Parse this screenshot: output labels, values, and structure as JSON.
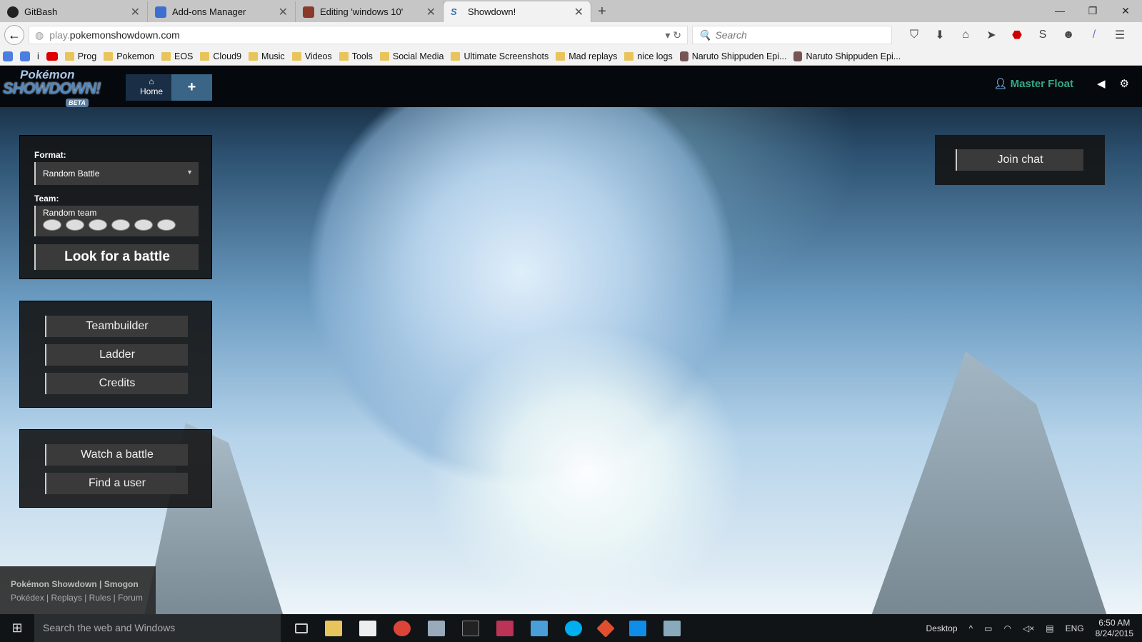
{
  "browser": {
    "tabs": [
      {
        "title": "GitBash",
        "icon": "github-icon"
      },
      {
        "title": "Add-ons Manager",
        "icon": "puzzle-icon"
      },
      {
        "title": "Editing 'windows 10'",
        "icon": "smogon-icon"
      },
      {
        "title": "Showdown!",
        "icon": "showdown-icon",
        "active": true
      }
    ],
    "new_tab": "+",
    "url_prefix": "play.",
    "url_domain": "pokemonshowdown.com",
    "search_placeholder": "Search",
    "bookmarks": [
      "i",
      "Prog",
      "Pokemon",
      "EOS",
      "Cloud9",
      "Music",
      "Videos",
      "Tools",
      "Social Media",
      "Ultimate Screenshots",
      "Mad replays",
      "nice logs",
      "Naruto Shippuden Epi...",
      "Naruto Shippuden Epi..."
    ]
  },
  "header": {
    "logo_top": "Pokémon",
    "logo_main": "SHOWDOWN!",
    "logo_badge": "BETA",
    "home": "Home",
    "add": "+",
    "username": "Master Float"
  },
  "battle_panel": {
    "format_label": "Format:",
    "format_value": "Random Battle",
    "team_label": "Team:",
    "team_value": "Random team",
    "look_button": "Look for a battle"
  },
  "menu": {
    "teambuilder": "Teambuilder",
    "ladder": "Ladder",
    "credits": "Credits",
    "watch": "Watch a battle",
    "find_user": "Find a user"
  },
  "chat": {
    "join": "Join chat"
  },
  "footer": {
    "line1": "Pokémon Showdown | Smogon",
    "links": [
      "Pokédex",
      "Replays",
      "Rules",
      "Forum"
    ]
  },
  "taskbar": {
    "search": "Search the web and Windows",
    "desktop": "Desktop",
    "lang": "ENG",
    "time": "6:50 AM",
    "date": "8/24/2015"
  },
  "colors": {
    "username": "#36a88a",
    "home_tab": "#1a2f45",
    "plus_tab": "#3b6587"
  }
}
